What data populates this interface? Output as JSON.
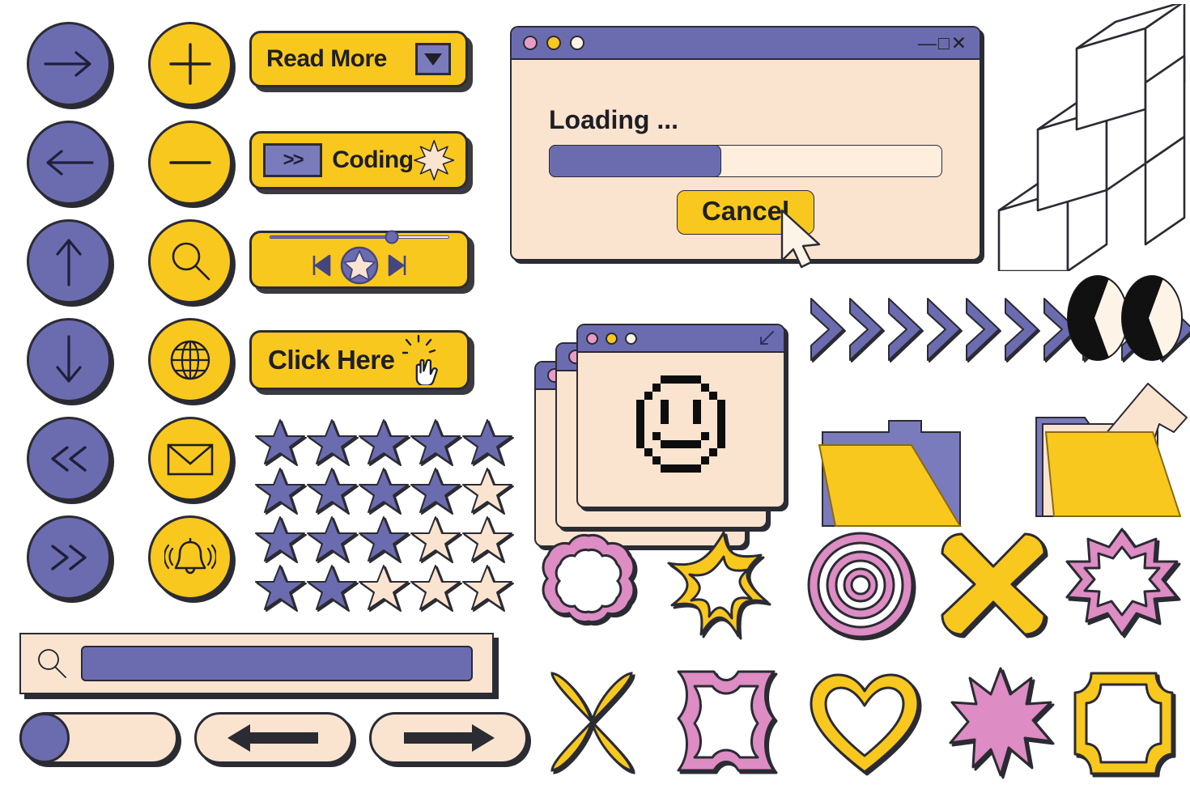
{
  "palette": {
    "purple": "#6b6cb0",
    "purple_light": "#7a7bbd",
    "yellow": "#f9c81e",
    "cream": "#fae4d0",
    "pink": "#dd8cc4",
    "ink": "#2b2b33",
    "white": "#ffffff"
  },
  "nav_circles_purple": [
    {
      "name": "arrow-right-icon",
      "glyph": "→"
    },
    {
      "name": "arrow-left-icon",
      "glyph": "←"
    },
    {
      "name": "arrow-up-icon",
      "glyph": "↑"
    },
    {
      "name": "arrow-down-icon",
      "glyph": "↓"
    },
    {
      "name": "double-chevron-left-icon",
      "glyph": "«"
    },
    {
      "name": "double-chevron-right-icon",
      "glyph": "»"
    }
  ],
  "action_circles_yellow": [
    {
      "name": "plus-icon",
      "glyph": "+"
    },
    {
      "name": "minus-icon",
      "glyph": "−"
    },
    {
      "name": "search-icon",
      "glyph": "search"
    },
    {
      "name": "globe-icon",
      "glyph": "globe"
    },
    {
      "name": "envelope-icon",
      "glyph": "envelope"
    },
    {
      "name": "bell-icon",
      "glyph": "bell"
    }
  ],
  "buttons": {
    "read_more": {
      "label": "Read More",
      "icon": "chevron-down-icon"
    },
    "coding": {
      "label": "Coding",
      "badge": ">>",
      "icon": "sparkle-icon"
    },
    "click_here": {
      "label": "Click Here",
      "icon": "hand-pointer-icon"
    }
  },
  "media_player": {
    "name": "media-player-button",
    "progress_percent": 68,
    "controls": [
      "skip-back-icon",
      "star-play-icon",
      "skip-forward-icon"
    ]
  },
  "loading_window": {
    "title_dots": [
      "pink",
      "yellow",
      "cream"
    ],
    "controls": "—□✕",
    "status_text": "Loading ...",
    "progress_percent": 44,
    "cancel_label": "Cancel",
    "cursor": "arrow-cursor-icon"
  },
  "smiley_window": {
    "title_dots": [
      "pink",
      "yellow",
      "cream"
    ],
    "resize_icon": "resize-diagonal-icon",
    "content": "pixel-smiley-face",
    "stack_count": 3
  },
  "star_rating": {
    "rows": [
      {
        "filled": 5,
        "total": 5
      },
      {
        "filled": 4,
        "total": 5
      },
      {
        "filled": 3,
        "total": 5
      },
      {
        "filled": 2,
        "total": 5
      }
    ]
  },
  "search": {
    "name": "search-bar",
    "icon": "search-icon",
    "value": "",
    "placeholder": ""
  },
  "bottom_controls": [
    {
      "name": "toggle-switch",
      "state": "off",
      "knob": "left"
    },
    {
      "name": "back-button",
      "icon": "arrow-left-bold-icon"
    },
    {
      "name": "forward-button",
      "icon": "arrow-right-bold-icon"
    }
  ],
  "chevron_strip": {
    "name": "chevron-arrow-strip",
    "count": 10,
    "direction": "right"
  },
  "eyes": {
    "name": "cartoon-eyes-icon",
    "count": 2
  },
  "cubes": {
    "name": "isometric-cube-stairs",
    "steps": 3
  },
  "folders": [
    {
      "name": "folder-closed-icon"
    },
    {
      "name": "folder-open-document-icon"
    }
  ],
  "shapes_row_1": [
    {
      "name": "flower-outline-shape",
      "color": "#dd8cc4"
    },
    {
      "name": "five-point-star-outline-shape",
      "color": "#f9c81e"
    },
    {
      "name": "concentric-target-shape",
      "color": "#dd8cc4"
    },
    {
      "name": "x-cross-shape",
      "color": "#f9c81e"
    },
    {
      "name": "nine-point-burst-outline-shape",
      "color": "#dd8cc4"
    }
  ],
  "shapes_row_2": [
    {
      "name": "four-petal-shape",
      "color": "#f9c81e"
    },
    {
      "name": "quatrefoil-outline-shape",
      "color": "#dd8cc4"
    },
    {
      "name": "heart-outline-shape",
      "color": "#f9c81e"
    },
    {
      "name": "nine-point-star-shape",
      "color": "#dd8cc4"
    },
    {
      "name": "concave-frame-shape",
      "color": "#f9c81e"
    }
  ]
}
